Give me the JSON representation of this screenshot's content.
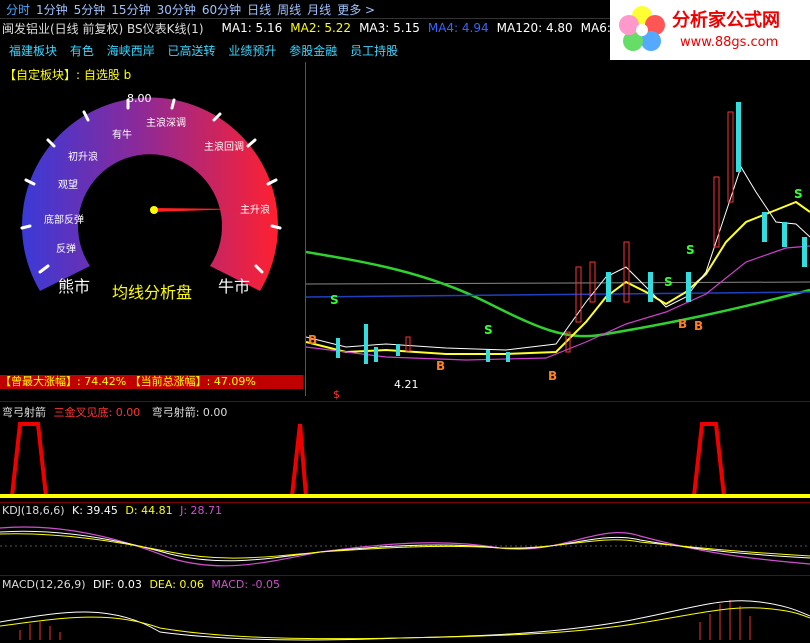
{
  "topbar": {
    "tabs": [
      "分时",
      "1分钟",
      "5分钟",
      "15分钟",
      "30分钟",
      "60分钟",
      "日线",
      "周线",
      "月线",
      "更多 >"
    ]
  },
  "titlebar": {
    "stock": "闽发铝业(日线 前复权) BS仪表K线(1)",
    "ma": [
      {
        "label": "MA1: 5.16",
        "color": "#ffffff"
      },
      {
        "label": "MA2: 5.22",
        "color": "#ffff00"
      },
      {
        "label": "MA3: 5.15",
        "color": "#ff00ff"
      },
      {
        "label": "MA4: 4.94",
        "color": "#0066ff"
      },
      {
        "label": "MA120: 4.80",
        "color": "#ffffff"
      },
      {
        "label": "MA6:",
        "color": "#ffffff"
      }
    ]
  },
  "tags": [
    "福建板块",
    "有色",
    "海峡西岸",
    "已高送转",
    "业绩预升",
    "参股金融",
    "员工持股"
  ],
  "left_panel": {
    "block_label": "【自定板块】: 自选股 b",
    "gauge_value": "8.00",
    "gauge_title": "均线分析盘",
    "zones": [
      "底部反弹",
      "观望",
      "初升浪",
      "有牛",
      "主浪深调",
      "主浪回调",
      "主升浪"
    ],
    "bear_label": "熊市",
    "bull_label": "牛市",
    "left_small": "反弹",
    "strip_left": "【曾最大涨幅】: 74.42%",
    "strip_right": "【当前总涨幅】: 47.09%"
  },
  "main_chart": {
    "low_label": "4.21",
    "signals_s": "S",
    "signals_b": "B",
    "dollar": "$"
  },
  "indicator1": {
    "name": "弯弓射箭",
    "line1": "三金叉见底: 0.00",
    "line2": "弯弓射箭: 0.00",
    "line1_color": "#ff3030"
  },
  "kdj": {
    "name": "KDJ(18,6,6)",
    "k": "K: 39.45",
    "d": "D: 44.81",
    "j": "J: 28.71"
  },
  "macd": {
    "name": "MACD(12,26,9)",
    "dif": "DIF: 0.03",
    "dea": "DEA: 0.06",
    "macd": "MACD: -0.05"
  },
  "logo": {
    "text": "分析家公式网",
    "url": "www.88gs.com"
  },
  "colors": {
    "accent_yellow": "#ffff00",
    "bull_red": "#ff2020",
    "bear_blue": "#3030ff",
    "cyan": "#39d6ff"
  }
}
